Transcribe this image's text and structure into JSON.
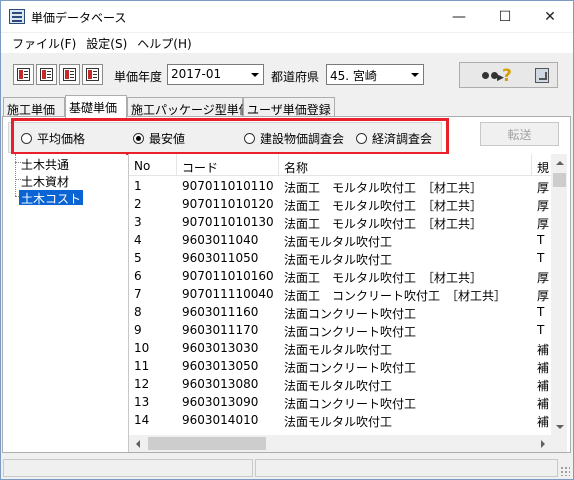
{
  "window": {
    "title": "単価データベース",
    "minimize_glyph": "—",
    "maximize_glyph": "☐",
    "close_glyph": "✕"
  },
  "menu": {
    "items": [
      "ファイル(F)",
      "設定(S)",
      "ヘルプ(H)"
    ]
  },
  "toolbar": {
    "year_label": "単価年度",
    "year_value": "2017-01",
    "pref_label": "都道府県",
    "pref_value": "45. 宮崎"
  },
  "tabs": [
    "施工単価",
    "基礎単価",
    "施工パッケージ型単価",
    "ユーザ単価登録"
  ],
  "active_tab": 1,
  "radios": [
    {
      "label": "平均価格",
      "selected": false
    },
    {
      "label": "最安値",
      "selected": true
    },
    {
      "label": "建設物価調査会",
      "selected": false
    },
    {
      "label": "経済調査会",
      "selected": false
    }
  ],
  "transfer_button": "転送",
  "tree": {
    "items": [
      "土木共通",
      "土木資材",
      "土木コスト"
    ],
    "selected": 2
  },
  "list": {
    "headers": [
      "No",
      "コード",
      "名称",
      "規"
    ],
    "rows": [
      [
        "1",
        "907011010110",
        "法面工　モルタル吹付工　［材工共］",
        "厚"
      ],
      [
        "2",
        "907011010120",
        "法面工　モルタル吹付工　［材工共］",
        "厚"
      ],
      [
        "3",
        "907011010130",
        "法面工　モルタル吹付工　［材工共］",
        "厚"
      ],
      [
        "4",
        "9603011040",
        "法面モルタル吹付工",
        "T"
      ],
      [
        "5",
        "9603011050",
        "法面モルタル吹付工",
        "T"
      ],
      [
        "6",
        "907011010160",
        "法面工　モルタル吹付工　［材工共］",
        "厚"
      ],
      [
        "7",
        "907011110040",
        "法面工　コンクリート吹付工　［材工共］",
        "厚"
      ],
      [
        "8",
        "9603011160",
        "法面コンクリート吹付工",
        "T"
      ],
      [
        "9",
        "9603011170",
        "法面コンクリート吹付工",
        "T"
      ],
      [
        "10",
        "9603013030",
        "法面モルタル吹付工",
        "補"
      ],
      [
        "11",
        "9603013050",
        "法面コンクリート吹付工",
        "補"
      ],
      [
        "12",
        "9603013080",
        "法面モルタル吹付工",
        "補"
      ],
      [
        "13",
        "9603013090",
        "法面コンクリート吹付工",
        "補"
      ],
      [
        "14",
        "9603014010",
        "法面モルタル吹付工",
        "補"
      ]
    ]
  }
}
